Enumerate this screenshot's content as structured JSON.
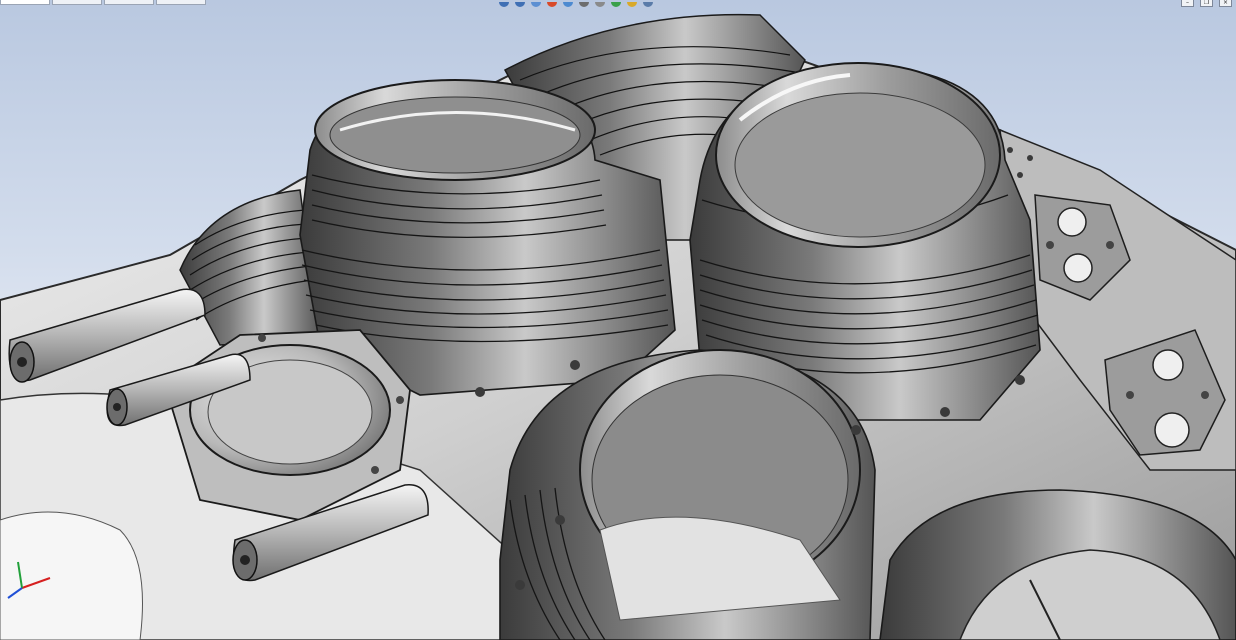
{
  "window": {
    "tabs": [
      {
        "label": ""
      },
      {
        "label": ""
      },
      {
        "label": ""
      },
      {
        "label": ""
      }
    ],
    "controls": [
      "minimize-icon",
      "restore-icon",
      "close-icon"
    ]
  },
  "view_toolbar": {
    "buttons": [
      {
        "icon": "zoom-to-fit-icon",
        "color": "#3f6fb4"
      },
      {
        "icon": "zoom-area-icon",
        "color": "#3f6fb4"
      },
      {
        "icon": "previous-view-icon",
        "color": "#5c8fd2"
      },
      {
        "icon": "section-view-icon",
        "color": "#d84a2a"
      },
      {
        "icon": "view-orientation-icon",
        "color": "#4d8ad0"
      },
      {
        "icon": "display-style-icon",
        "color": "#6d6d6d"
      },
      {
        "icon": "hide-show-items-icon",
        "color": "#8a8a8a"
      },
      {
        "icon": "edit-appearance-icon",
        "color": "#3aa04a"
      },
      {
        "icon": "apply-scene-icon",
        "color": "#d9a92a"
      },
      {
        "icon": "view-settings-icon",
        "color": "#5a7ba8"
      }
    ]
  },
  "model": {
    "description_colors": {
      "metal_light": "#e6e6e6",
      "metal_mid": "#a9a9a9",
      "metal_dark": "#4a4a4a",
      "edge": "#1c1c1c"
    }
  },
  "triad": {
    "axis_colors": {
      "x": "#d62020",
      "y": "#21a03a",
      "z": "#2050d6"
    }
  }
}
